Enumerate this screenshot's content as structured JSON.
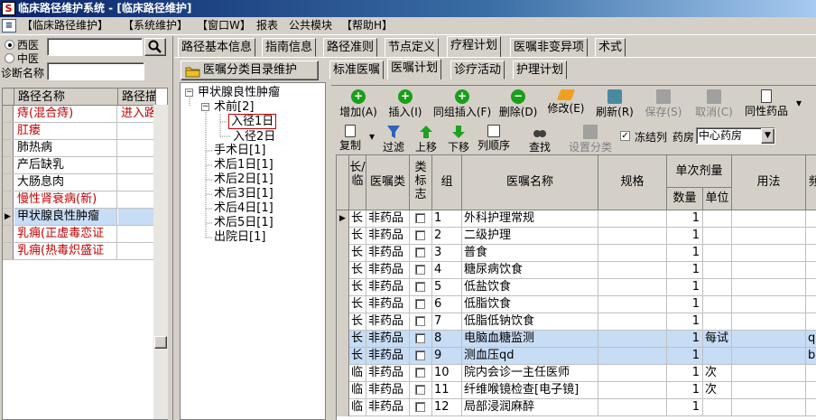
{
  "window": {
    "title": "临床路径维护系统 - [临床路径维护]"
  },
  "menu": {
    "items": [
      "【临床路径维护】",
      "【系统维护】",
      "【窗口W】",
      "报表",
      "公共模块",
      "【帮助H】"
    ]
  },
  "left": {
    "radio_western": "西医",
    "radio_chinese": "中医",
    "diagnosis_label": "诊断名称",
    "search_value": "",
    "diagnosis_value": "",
    "grid_headers": [
      "路径名称",
      "路径描"
    ],
    "rows": [
      {
        "name": "痔(混合痔)",
        "desc": "进入路",
        "red": true,
        "selected": false,
        "indicator": ""
      },
      {
        "name": "肛瘘",
        "desc": "",
        "red": true,
        "selected": false,
        "indicator": ""
      },
      {
        "name": "肺热病",
        "desc": "",
        "red": false,
        "selected": false,
        "indicator": ""
      },
      {
        "name": "产后缺乳",
        "desc": "",
        "red": false,
        "selected": false,
        "indicator": ""
      },
      {
        "name": "大肠息肉",
        "desc": "",
        "red": false,
        "selected": false,
        "indicator": ""
      },
      {
        "name": "慢性肾衰病(新)",
        "desc": "",
        "red": true,
        "selected": false,
        "indicator": ""
      },
      {
        "name": "甲状腺良性肿瘤",
        "desc": "",
        "red": false,
        "selected": true,
        "indicator": "▶"
      },
      {
        "name": "乳痈(正虚毒恋证",
        "desc": "",
        "red": true,
        "selected": false,
        "indicator": ""
      },
      {
        "name": "乳痈(热毒炽盛证",
        "desc": "",
        "red": true,
        "selected": false,
        "indicator": ""
      }
    ]
  },
  "tabs_top": [
    "路径基本信息",
    "指南信息",
    "路径准则",
    "节点定义",
    "疗程计划",
    "医嘱非变异项",
    "术式"
  ],
  "tabs_top_active": "疗程计划",
  "catalog_button": "医嘱分类目录维护",
  "tabs_sub": [
    "标准医嘱",
    "医嘱计划",
    "诊疗活动",
    "护理计划"
  ],
  "tabs_sub_active": "医嘱计划",
  "tree": {
    "root": "甲状腺良性肿瘤",
    "nodes": [
      "术前[2]",
      "入径1日",
      "入径2日",
      "手术日[1]",
      "术后1日[1]",
      "术后2日[1]",
      "术后3日[1]",
      "术后4日[1]",
      "术后5日[1]",
      "出院日[1]"
    ]
  },
  "toolbar": {
    "add": "增加(A)",
    "insert": "插入(I)",
    "group_insert": "同组插入(F)",
    "delete": "删除(D)",
    "modify": "修改(E)",
    "refresh": "刷新(R)",
    "save": "保存(S)",
    "cancel": "取消(C)",
    "same_group_drug": "同性药品",
    "copy": "复制",
    "filter": "过滤",
    "move_up": "上移",
    "move_down": "下移",
    "column_order": "列顺序",
    "find": "查找",
    "set_category": "设置分类",
    "freeze_label": "冻结列",
    "pharmacy_label": "药房",
    "pharmacy_value": "中心药房",
    "freeze_checked": true
  },
  "grid": {
    "headers": {
      "longtemp": "长/临",
      "order_type": "医嘱类",
      "type_flag": "类标志",
      "group": "组",
      "order_name": "医嘱名称",
      "spec": "规格",
      "single_dose": "单次剂量",
      "qty": "数量",
      "unit": "单位",
      "usage": "用法",
      "freq": "频"
    },
    "rows": [
      {
        "lt": "长",
        "type": "非药品",
        "group": "1",
        "name": "外科护理常规",
        "qty": "1",
        "unit": "",
        "usage": "",
        "freq": "",
        "hl": false,
        "cur": true
      },
      {
        "lt": "长",
        "type": "非药品",
        "group": "2",
        "name": "二级护理",
        "qty": "1",
        "unit": "",
        "usage": "",
        "freq": "",
        "hl": false,
        "cur": false
      },
      {
        "lt": "长",
        "type": "非药品",
        "group": "3",
        "name": "普食",
        "qty": "1",
        "unit": "",
        "usage": "",
        "freq": "",
        "hl": false,
        "cur": false
      },
      {
        "lt": "长",
        "type": "非药品",
        "group": "4",
        "name": "糖尿病饮食",
        "qty": "1",
        "unit": "",
        "usage": "",
        "freq": "",
        "hl": false,
        "cur": false
      },
      {
        "lt": "长",
        "type": "非药品",
        "group": "5",
        "name": "低盐饮食",
        "qty": "1",
        "unit": "",
        "usage": "",
        "freq": "",
        "hl": false,
        "cur": false
      },
      {
        "lt": "长",
        "type": "非药品",
        "group": "6",
        "name": "低脂饮食",
        "qty": "1",
        "unit": "",
        "usage": "",
        "freq": "",
        "hl": false,
        "cur": false
      },
      {
        "lt": "长",
        "type": "非药品",
        "group": "7",
        "name": "低脂低钠饮食",
        "qty": "1",
        "unit": "",
        "usage": "",
        "freq": "",
        "hl": false,
        "cur": false
      },
      {
        "lt": "长",
        "type": "非药品",
        "group": "8",
        "name": "电脑血糖监测",
        "qty": "1",
        "unit": "每试",
        "usage": "",
        "freq": "q:",
        "hl": true,
        "cur": false
      },
      {
        "lt": "长",
        "type": "非药品",
        "group": "9",
        "name": "测血压qd",
        "qty": "1",
        "unit": "",
        "usage": "",
        "freq": "b:",
        "hl": true,
        "cur": false
      },
      {
        "lt": "临",
        "type": "非药品",
        "group": "10",
        "name": "院内会诊一主任医师",
        "qty": "1",
        "unit": "次",
        "usage": "",
        "freq": "",
        "hl": false,
        "cur": false
      },
      {
        "lt": "临",
        "type": "非药品",
        "group": "11",
        "name": "纤维喉镜检查[电子镜]",
        "qty": "1",
        "unit": "次",
        "usage": "",
        "freq": "",
        "hl": false,
        "cur": false
      },
      {
        "lt": "临",
        "type": "非药品",
        "group": "12",
        "name": "局部浸润麻醉",
        "qty": "1",
        "unit": "",
        "usage": "",
        "freq": "",
        "hl": false,
        "cur": false
      }
    ]
  },
  "colors": {
    "title_start": "#0a246a",
    "highlight_row": "#c7dcf5",
    "red_text": "#c00000",
    "face": "#d4d0c8"
  }
}
